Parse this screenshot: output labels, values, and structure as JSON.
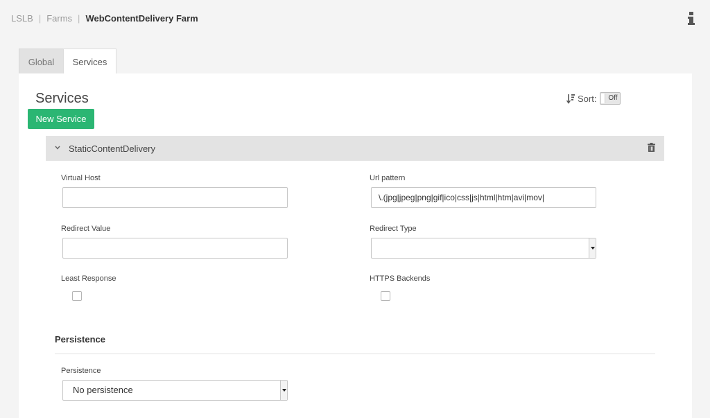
{
  "breadcrumb": {
    "items": [
      "LSLB",
      "Farms",
      "WebContentDelivery Farm"
    ],
    "separator": "|"
  },
  "tabs": [
    {
      "label": "Global",
      "active": false
    },
    {
      "label": "Services",
      "active": true
    }
  ],
  "services_section": {
    "title": "Services",
    "new_service_label": "New Service",
    "sort_label": "Sort:",
    "sort_toggle": "Off"
  },
  "service": {
    "name": "StaticContentDelivery",
    "fields": {
      "virtual_host": {
        "label": "Virtual Host",
        "value": ""
      },
      "url_pattern": {
        "label": "Url pattern",
        "value": "\\.(jpg|jpeg|png|gif|ico|css|js|html|htm|avi|mov|"
      },
      "redirect_value": {
        "label": "Redirect Value",
        "value": ""
      },
      "redirect_type": {
        "label": "Redirect Type",
        "value": ""
      },
      "least_response": {
        "label": "Least Response",
        "checked": false
      },
      "https_backends": {
        "label": "HTTPS Backends",
        "checked": false
      }
    },
    "persistence_section": {
      "title": "Persistence",
      "persistence_label": "Persistence",
      "persistence_value": "No persistence"
    }
  },
  "colors": {
    "primary_button": "#2bb673",
    "header_bg": "#e3e3e3",
    "page_bg": "#f4f4f4"
  },
  "icons": [
    "info-icon",
    "sort-icon",
    "chevron-down-icon",
    "trash-icon"
  ]
}
